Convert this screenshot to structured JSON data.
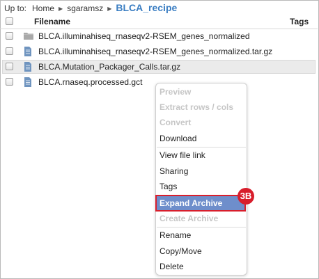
{
  "breadcrumb": {
    "label": "Up to:",
    "items": [
      "Home",
      "sgaramsz"
    ],
    "current": "BLCA_recipe"
  },
  "table": {
    "columns": {
      "filename": "Filename",
      "tags": "Tags"
    },
    "rows": [
      {
        "name": "BLCA.illuminahiseq_rnaseqv2-RSEM_genes_normalized",
        "icon": "folder-icon"
      },
      {
        "name": "BLCA.illuminahiseq_rnaseqv2-RSEM_genes_normalized.tar.gz",
        "icon": "file-icon"
      },
      {
        "name": "BLCA.Mutation_Packager_Calls.tar.gz",
        "icon": "file-icon",
        "selected": true
      },
      {
        "name": "BLCA.rnaseq.processed.gct",
        "icon": "file-icon"
      }
    ]
  },
  "context_menu": {
    "items": [
      {
        "label": "Preview",
        "state": "disabled"
      },
      {
        "label": "Extract rows / cols",
        "state": "disabled"
      },
      {
        "label": "Convert",
        "state": "disabled"
      },
      {
        "label": "Download",
        "state": "enabled"
      },
      {
        "label": "View file link",
        "state": "enabled"
      },
      {
        "label": "Sharing",
        "state": "enabled"
      },
      {
        "label": "Tags",
        "state": "enabled"
      },
      {
        "label": "Expand Archive",
        "state": "highlighted"
      },
      {
        "label": "Create Archive",
        "state": "disabled"
      },
      {
        "label": "Rename",
        "state": "enabled"
      },
      {
        "label": "Copy/Move",
        "state": "enabled"
      },
      {
        "label": "Delete",
        "state": "enabled"
      }
    ]
  },
  "annotation_badge": "3B",
  "colors": {
    "accent": "#3a7dc2",
    "highlight": "#6e8ecb",
    "callout": "#d81e2c"
  }
}
